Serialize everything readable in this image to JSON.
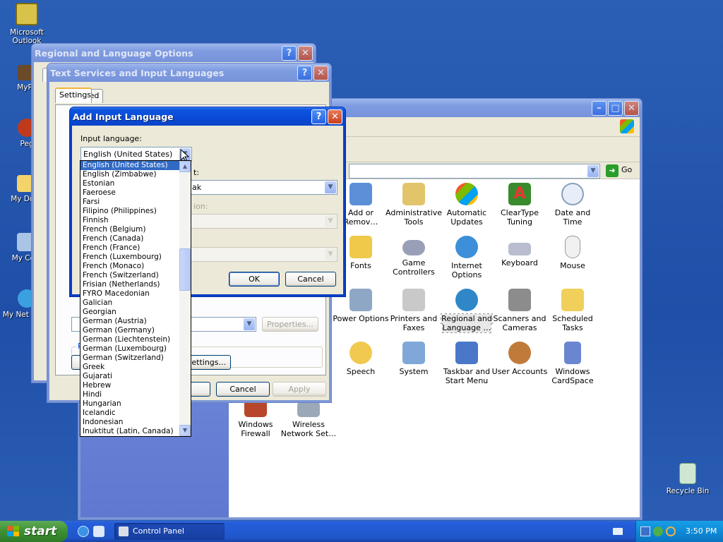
{
  "desktop_icons": [
    {
      "label": "Microsoft Outlook",
      "icon": "outlook-icon"
    },
    {
      "label": "MyPa",
      "icon": "briefcase-icon"
    },
    {
      "label": "Peg",
      "icon": "pegasus-icon"
    },
    {
      "label": "My Docu",
      "icon": "folder-icon"
    },
    {
      "label": "My Com",
      "icon": "computer-icon"
    },
    {
      "label": "My Net Place",
      "icon": "network-icon"
    },
    {
      "label": "Recycle Bin",
      "icon": "recycle-bin-icon"
    }
  ],
  "control_panel": {
    "address_go": "Go",
    "items": [
      {
        "label": "Add or Remov…",
        "icon": "add-remove-icon"
      },
      {
        "label": "Administrative Tools",
        "icon": "admin-tools-icon"
      },
      {
        "label": "Automatic Updates",
        "icon": "updates-icon"
      },
      {
        "label": "ClearType Tuning",
        "icon": "cleartype-icon"
      },
      {
        "label": "Date and Time",
        "icon": "clock-icon"
      },
      {
        "label": "Fonts",
        "icon": "fonts-icon"
      },
      {
        "label": "Game Controllers",
        "icon": "gamepad-icon"
      },
      {
        "label": "Internet Options",
        "icon": "globe-icon"
      },
      {
        "label": "Keyboard",
        "icon": "keyboard-icon"
      },
      {
        "label": "Mouse",
        "icon": "mouse-icon"
      },
      {
        "label": "Power Options",
        "icon": "power-icon"
      },
      {
        "label": "Printers and Faxes",
        "icon": "printer-icon"
      },
      {
        "label": "Regional and Language …",
        "icon": "regional-icon"
      },
      {
        "label": "Scanners and Cameras",
        "icon": "camera-icon"
      },
      {
        "label": "Scheduled Tasks",
        "icon": "tasks-icon"
      },
      {
        "label": "Speech",
        "icon": "speech-icon"
      },
      {
        "label": "System",
        "icon": "system-icon"
      },
      {
        "label": "Taskbar and Start Menu",
        "icon": "taskbar-icon"
      },
      {
        "label": "User Accounts",
        "icon": "users-icon"
      },
      {
        "label": "Windows CardSpace",
        "icon": "cardspace-icon"
      },
      {
        "label": "Windows Firewall",
        "icon": "firewall-icon"
      },
      {
        "label": "Wireless Network Set…",
        "icon": "wireless-icon"
      }
    ]
  },
  "regional_window": {
    "title": "Regional and Language Options",
    "tab_stub": "R"
  },
  "text_services_window": {
    "title": "Text Services and Input Languages",
    "tabs": [
      "Settings",
      "Advanced"
    ],
    "pref_label": "Pre",
    "lang_bar_btn": "ettings...",
    "properties_btn": "Properties...",
    "cancel_btn": "Cancel",
    "apply_btn": "Apply"
  },
  "add_input_dialog": {
    "title": "Add Input Language",
    "input_language_label": "Input language:",
    "selected": "English (United States)",
    "keyboard_label_fragment": "t:",
    "keyboard_value_fragment": "ak",
    "disabled_label_fragment": "ion:",
    "ok_btn": "OK",
    "cancel_btn": "Cancel"
  },
  "language_list": [
    "English (United States)",
    "English (Zimbabwe)",
    "Estonian",
    "Faeroese",
    "Farsi",
    "Filipino (Philippines)",
    "Finnish",
    "French (Belgium)",
    "French (Canada)",
    "French (France)",
    "French (Luxembourg)",
    "French (Monaco)",
    "French (Switzerland)",
    "Frisian (Netherlands)",
    "FYRO Macedonian",
    "Galician",
    "Georgian",
    "German (Austria)",
    "German (Germany)",
    "German (Liechtenstein)",
    "German (Luxembourg)",
    "German (Switzerland)",
    "Greek",
    "Gujarati",
    "Hebrew",
    "Hindi",
    "Hungarian",
    "Icelandic",
    "Indonesian",
    "Inuktitut (Latin, Canada)"
  ],
  "taskbar": {
    "start": "start",
    "task": "Control Panel",
    "clock": "3:50 PM"
  }
}
